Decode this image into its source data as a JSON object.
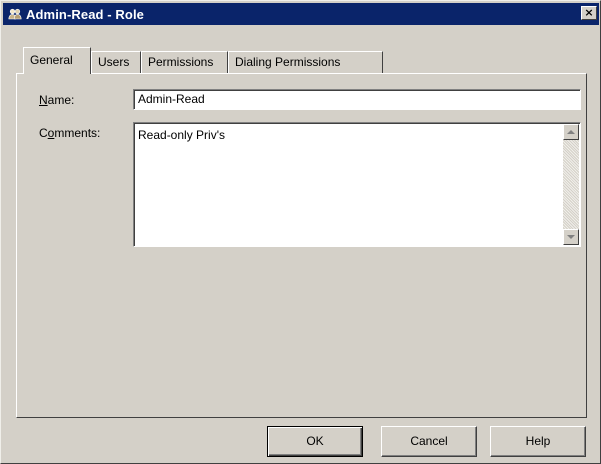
{
  "window": {
    "title": "Admin-Read - Role",
    "title_icon": "roles-icon",
    "close_label": "×"
  },
  "tabs": [
    {
      "label": "General",
      "active": true
    },
    {
      "label": "Users",
      "active": false
    },
    {
      "label": "Permissions",
      "active": false
    },
    {
      "label": "Dialing Permissions",
      "active": false
    }
  ],
  "form": {
    "name_label": "Name:",
    "name_accel": "N",
    "name_rest": "ame:",
    "name_value": "Admin-Read",
    "comments_label": "Comments:",
    "comments_accel_pre": "C",
    "comments_accel": "o",
    "comments_rest": "mments:",
    "comments_value": "Read-only Priv's"
  },
  "buttons": {
    "ok": "OK",
    "cancel": "Cancel",
    "help": "Help"
  },
  "colors": {
    "titlebar": "#0a246a",
    "face": "#d4d0c8"
  }
}
